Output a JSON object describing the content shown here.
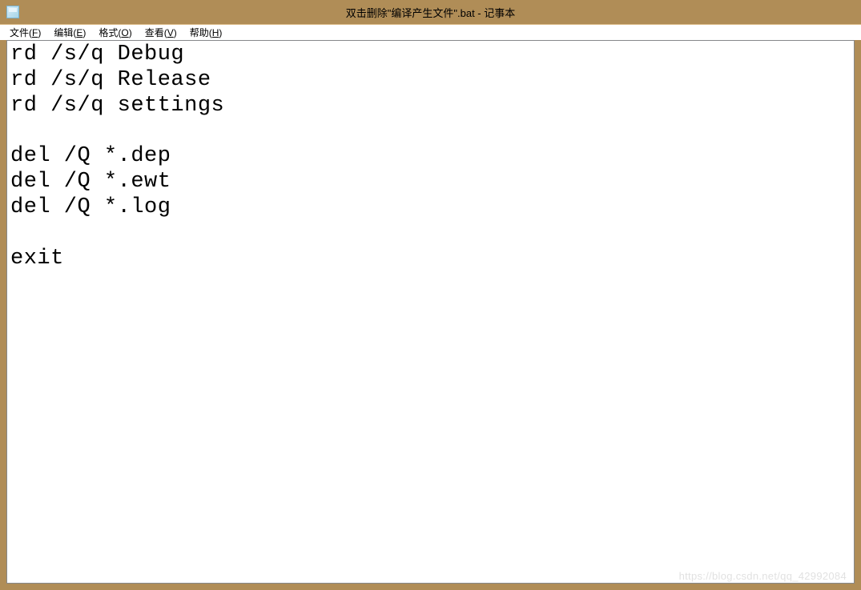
{
  "window": {
    "title": "双击删除\"编译产生文件\".bat - 记事本"
  },
  "menu": {
    "file": "文件(F)",
    "edit": "编辑(E)",
    "format": "格式(O)",
    "view": "查看(V)",
    "help": "帮助(H)"
  },
  "editor": {
    "content": "rd /s/q Debug\nrd /s/q Release\nrd /s/q settings\n\ndel /Q *.dep\ndel /Q *.ewt\ndel /Q *.log\n\nexit"
  },
  "watermark": "https://blog.csdn.net/qq_42992084"
}
